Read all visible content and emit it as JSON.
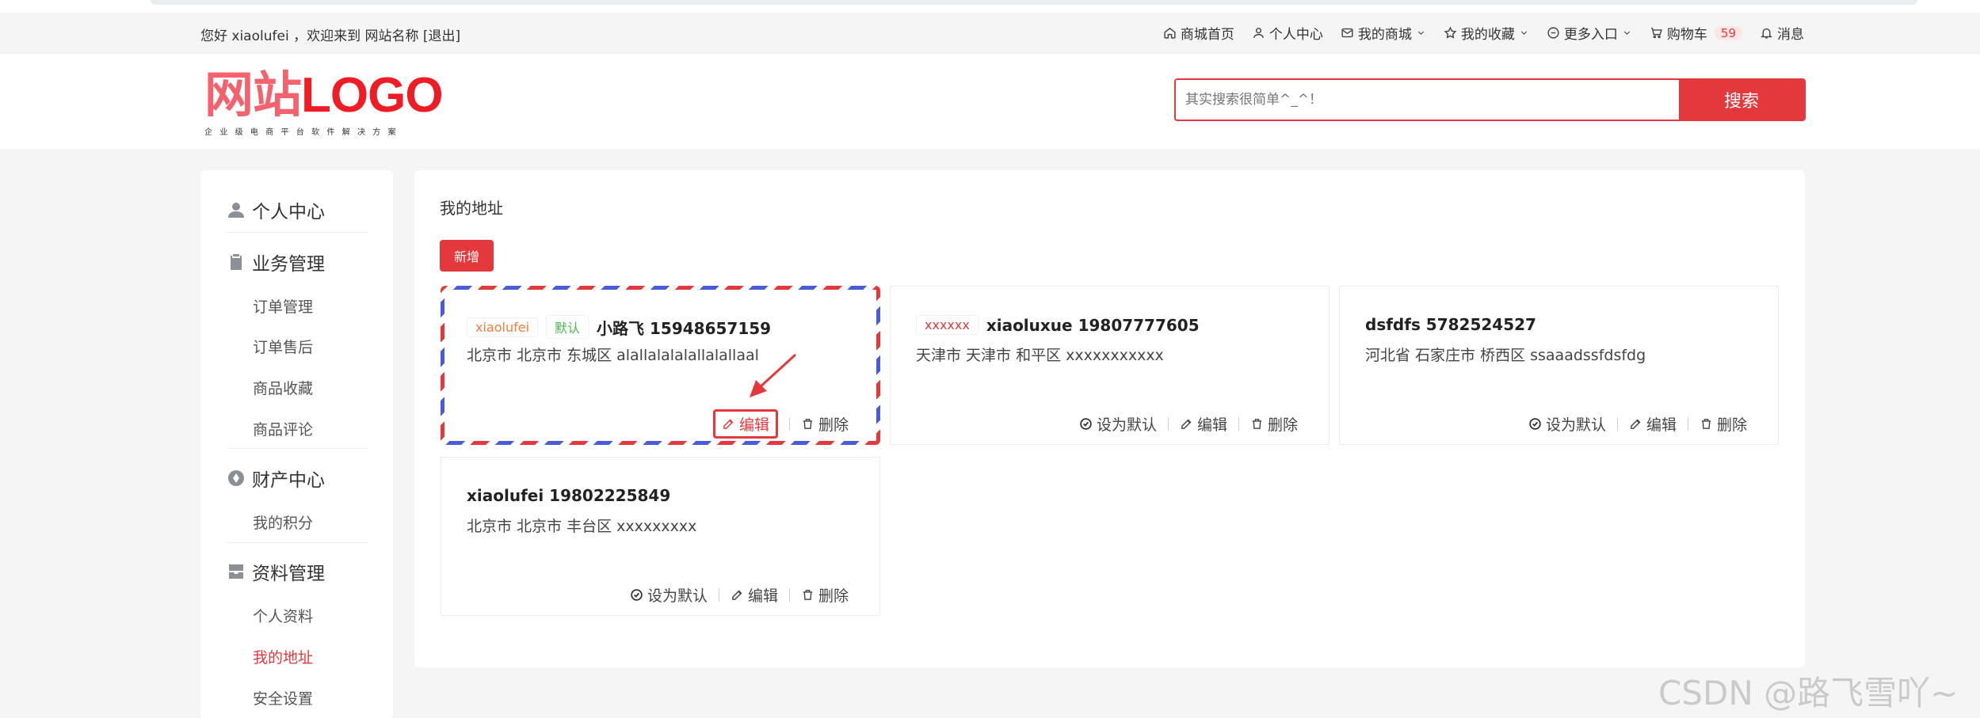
{
  "topbar": {
    "welcome": "您好 xiaolufei ，欢迎来到 网站名称 [退出]",
    "links": {
      "home": "商城首页",
      "center": "个人中心",
      "shop": "我的商城",
      "favorites": "我的收藏",
      "more": "更多入口",
      "cart": "购物车",
      "cart_count": "59",
      "message": "消息"
    }
  },
  "header": {
    "logo_cn": "网站",
    "logo_en": "LOGO",
    "logo_sub": "企业级电商平台软件解决方案",
    "search_placeholder": "其实搜索很简单^_^！",
    "search_button": "搜索"
  },
  "sidebar": {
    "personal": "个人中心",
    "business": "业务管理",
    "business_items": [
      "订单管理",
      "订单售后",
      "商品收藏",
      "商品评论"
    ],
    "assets": "财产中心",
    "assets_items": [
      "我的积分"
    ],
    "profile": "资料管理",
    "profile_items": [
      "个人资料",
      "我的地址",
      "安全设置"
    ]
  },
  "main": {
    "title": "我的地址",
    "add_button": "新增",
    "actions": {
      "set_default": "设为默认",
      "edit": "编辑",
      "delete": "删除"
    },
    "addresses": [
      {
        "alias": "xiaolufei",
        "default_tag": "默认",
        "name_phone": "小路飞 15948657159",
        "address": "北京市 北京市 东城区 alallalalalallalallaal"
      },
      {
        "alias": "xxxxxx",
        "name_phone": "xiaoluxue 19807777605",
        "address": "天津市 天津市 和平区 xxxxxxxxxxx"
      },
      {
        "name_phone": "dsfdfs 5782524527",
        "address": "河北省 石家庄市 桥西区 ssaaadssfdsfdg"
      },
      {
        "name_phone": "xiaolufei 19802225849",
        "address": "北京市 北京市 丰台区 xxxxxxxxx"
      }
    ]
  },
  "watermark": "CSDN @路飞雪吖~",
  "colors": {
    "accent": "#e4393c",
    "orange_tag": "#f27c3a",
    "green_tag": "#4cb94c",
    "dash_blue": "#4a5bd9"
  }
}
